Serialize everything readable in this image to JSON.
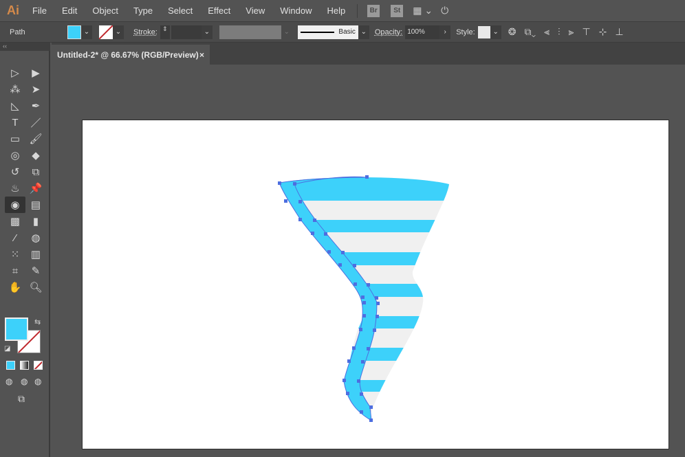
{
  "app": {
    "logo": "Ai"
  },
  "menu": [
    "File",
    "Edit",
    "Object",
    "Type",
    "Select",
    "Effect",
    "View",
    "Window",
    "Help"
  ],
  "menu_icons": {
    "bridge": "Br",
    "stock": "St"
  },
  "control": {
    "selection_type": "Path",
    "stroke_label": "Stroke:",
    "brush_label": "Basic",
    "opacity_label": "Opacity:",
    "opacity_value": "100%",
    "style_label": "Style:"
  },
  "document_tab": {
    "title": "Untitled-2* @ 66.67% (RGB/Preview)",
    "close": "×"
  },
  "colors": {
    "fill": "#3dd1fa",
    "stripe_light": "#f0f0f0",
    "selection": "#4d6ee0"
  }
}
